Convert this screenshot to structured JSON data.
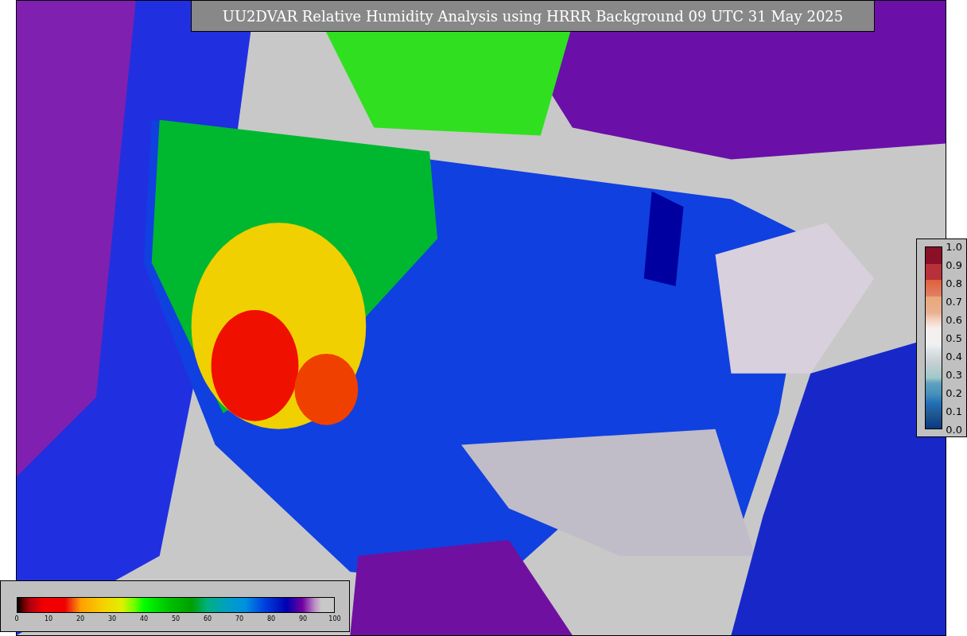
{
  "title": "UU2DVAR Relative Humidity Analysis using HRRR Background 09 UTC 31 May 2025",
  "humidity_colorbar": {
    "ticks": [
      "0",
      "10",
      "20",
      "30",
      "40",
      "50",
      "60",
      "70",
      "80",
      "90",
      "100"
    ]
  },
  "observation_colorbar": {
    "ticks": [
      "1.0",
      "0.9",
      "0.8",
      "0.7",
      "0.6",
      "0.5",
      "0.4",
      "0.3",
      "0.2",
      "0.1",
      "0.0"
    ]
  }
}
